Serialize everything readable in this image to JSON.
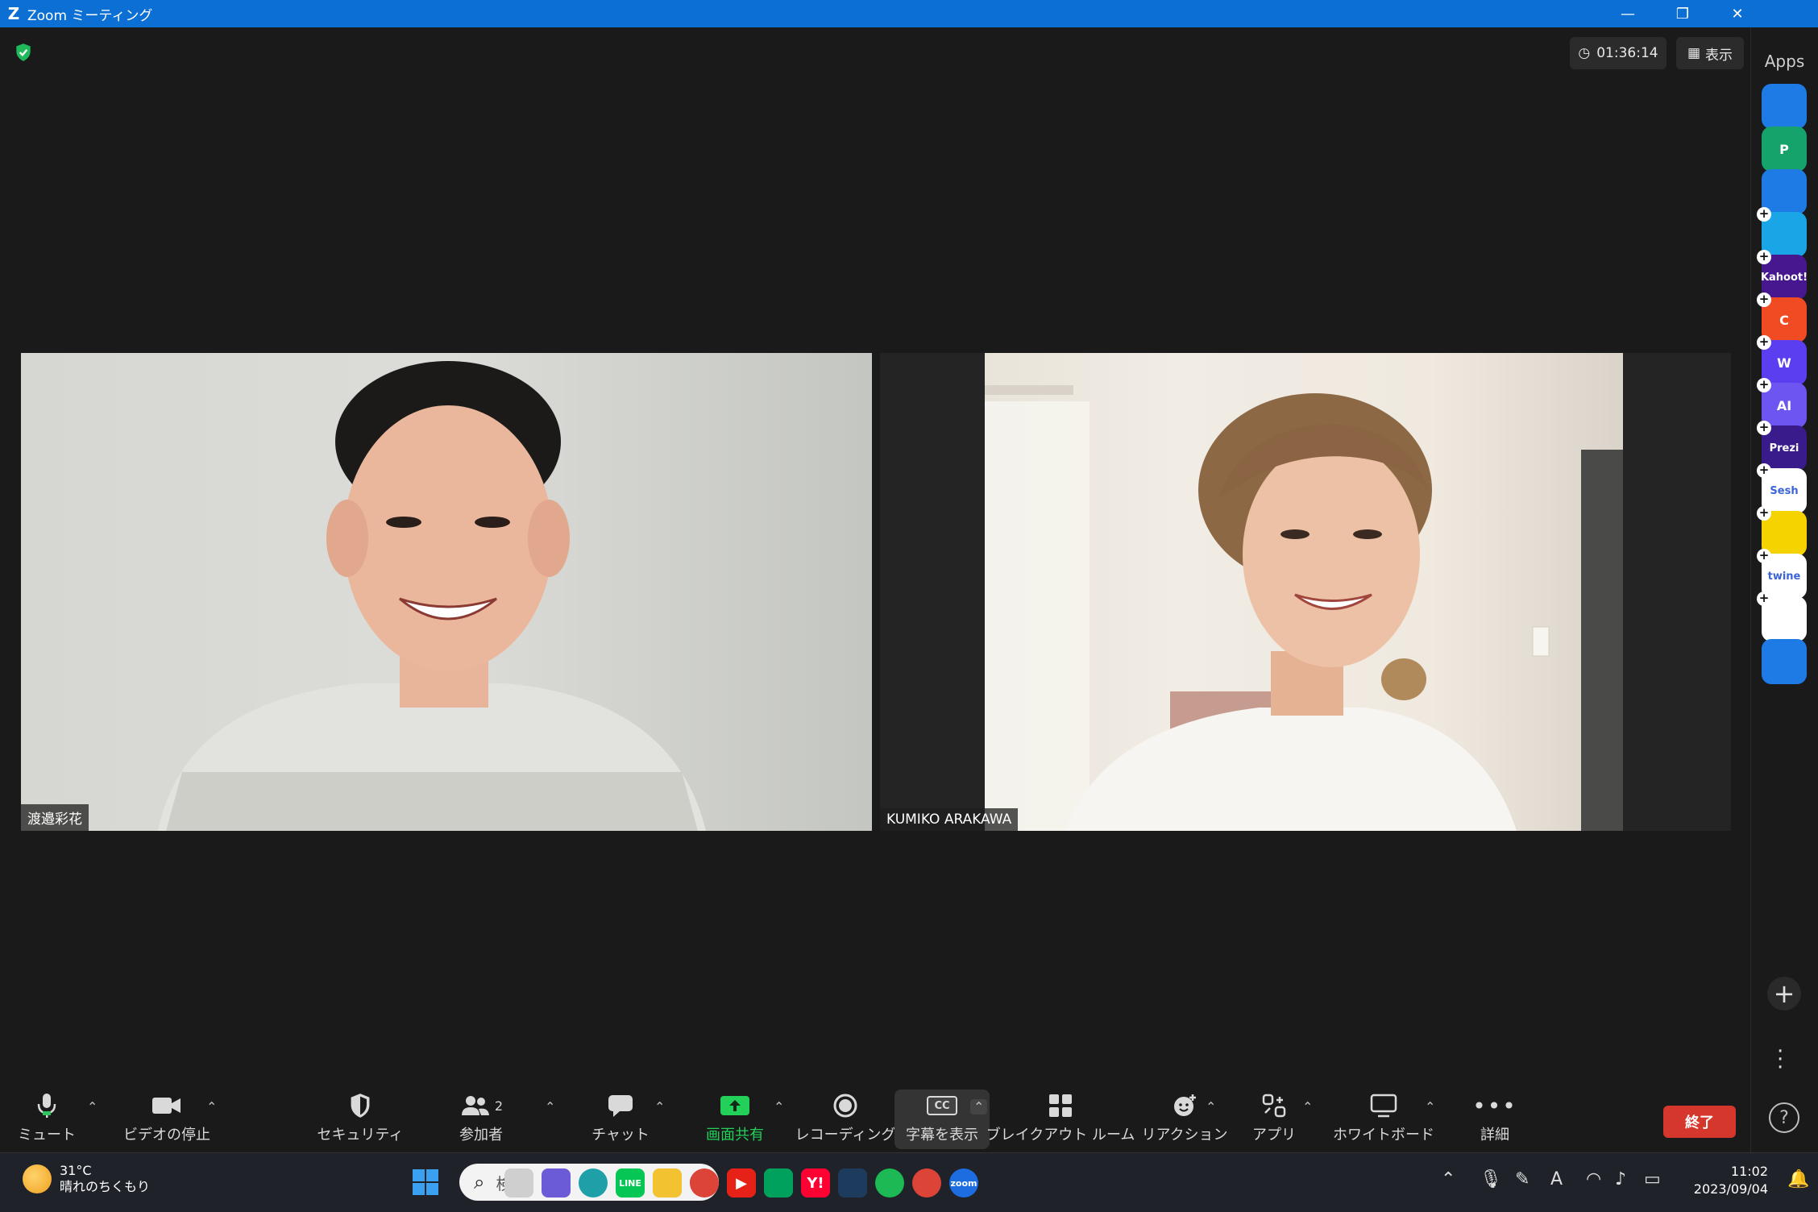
{
  "window": {
    "title": "Zoom ミーティング"
  },
  "meeting": {
    "timer": "01:36:14",
    "view_label": "表示",
    "participants": [
      {
        "name": "渡邉彩花"
      },
      {
        "name": "KUMIKO ARAKAWA"
      }
    ]
  },
  "apps_panel": {
    "title": "Apps",
    "apps": [
      {
        "name": "smile-app",
        "text": "",
        "color": "#1e7be6"
      },
      {
        "name": "p-app",
        "text": "P",
        "color": "#16a36b"
      },
      {
        "name": "timer-app",
        "text": "",
        "color": "#1e7be6"
      },
      {
        "name": "flow-app",
        "text": "",
        "color": "#1aa6e6"
      },
      {
        "name": "kahoot-app",
        "text": "Kahoot!",
        "color": "#46178f"
      },
      {
        "name": "c-app",
        "text": "C",
        "color": "#f04b23"
      },
      {
        "name": "w-app",
        "text": "W",
        "color": "#5b3ef0"
      },
      {
        "name": "ai-app",
        "text": "AI",
        "color": "#6c55f0"
      },
      {
        "name": "prezi-app",
        "text": "Prezi",
        "color": "#3a1b8c"
      },
      {
        "name": "sesh-app",
        "text": "Sesh",
        "color": "#ffffff"
      },
      {
        "name": "emoji-app",
        "text": "",
        "color": "#f5d300"
      },
      {
        "name": "twine-app",
        "text": "twine",
        "color": "#ffffff"
      },
      {
        "name": "blocks-app",
        "text": "",
        "color": "#ffffff"
      },
      {
        "name": "clock-app",
        "text": "",
        "color": "#1e7be6"
      }
    ]
  },
  "toolbar": {
    "mute": "ミュート",
    "video": "ビデオの停止",
    "security": "セキュリティ",
    "participants": "参加者",
    "participants_count": "2",
    "chat": "チャット",
    "share": "画面共有",
    "recording": "レコーディング",
    "captions": "字幕を表示",
    "cc": "CC",
    "breakout": "ブレイクアウト ルーム",
    "reactions": "リアクション",
    "apps": "アプリ",
    "whiteboard": "ホワイトボード",
    "more": "詳細",
    "end": "終了"
  },
  "taskbar": {
    "weather_temp": "31°C",
    "weather_desc": "晴れのちくもり",
    "search_placeholder": "検索",
    "time": "11:02",
    "date": "2023/09/04",
    "apps": [
      {
        "name": "windows-start",
        "text": "",
        "color": "#3aa0f0"
      },
      {
        "name": "task-view",
        "text": "",
        "color": "#cfcfcf"
      },
      {
        "name": "teams-chat",
        "text": "",
        "color": "#6b5bd6"
      },
      {
        "name": "edge",
        "text": "",
        "color": "#1fa0a8"
      },
      {
        "name": "line",
        "text": "LINE",
        "color": "#06c755"
      },
      {
        "name": "file-explorer",
        "text": "",
        "color": "#f2c230"
      },
      {
        "name": "chrome",
        "text": "",
        "color": "#dc4437"
      },
      {
        "name": "youtube",
        "text": "▶",
        "color": "#e62117"
      },
      {
        "name": "google-chat",
        "text": "",
        "color": "#00a15c"
      },
      {
        "name": "yahoo",
        "text": "Y!",
        "color": "#ff0033"
      },
      {
        "name": "dev-app",
        "text": "",
        "color": "#1d3b5c"
      },
      {
        "name": "spotify",
        "text": "",
        "color": "#1db954"
      },
      {
        "name": "chrome-profile",
        "text": "",
        "color": "#dc4437"
      },
      {
        "name": "zoom",
        "text": "zoom",
        "color": "#1b6de0"
      }
    ]
  }
}
